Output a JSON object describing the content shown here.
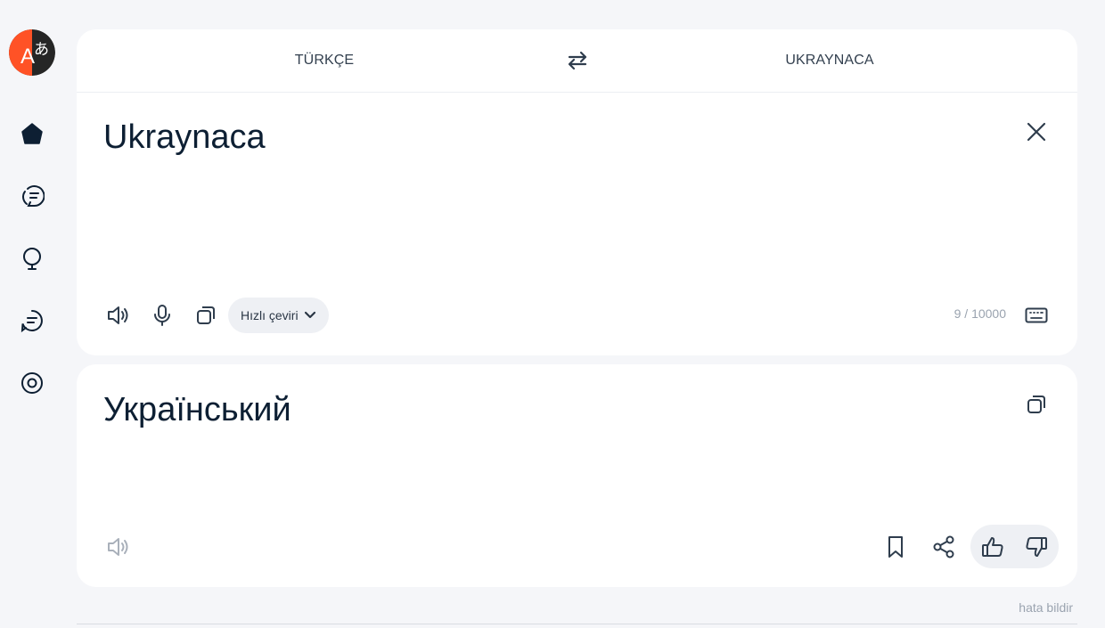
{
  "logo": {
    "icon": "translate-logo-icon",
    "colors": {
      "left": "#ff5226",
      "right": "#262626"
    },
    "glyphs": "A あ"
  },
  "sidebar": {
    "items": [
      {
        "name": "home",
        "icon": "home-icon"
      },
      {
        "name": "dialogue",
        "icon": "chat-bubbles-icon"
      },
      {
        "name": "ideas",
        "icon": "lightbulb-icon"
      },
      {
        "name": "documents",
        "icon": "document-icon"
      },
      {
        "name": "camera",
        "icon": "camera-icon"
      }
    ]
  },
  "languages": {
    "source": "TÜRKÇE",
    "target": "UKRAYNACA",
    "swap_icon": "swap-arrows-icon"
  },
  "source": {
    "text": "Ukraynaca",
    "counter": "9 / 10000",
    "quick_translate_label": "Hızlı çeviri",
    "icons": [
      "speaker-icon",
      "microphone-icon",
      "copy-icon",
      "chevron-down-icon",
      "keyboard-icon",
      "close-icon"
    ]
  },
  "result": {
    "text": "Український",
    "icons": [
      "speaker-icon",
      "copy-icon",
      "bookmark-icon",
      "share-icon",
      "thumbs-up-icon",
      "thumbs-down-icon"
    ]
  },
  "footer": {
    "report_label": "hata bildir"
  },
  "colors": {
    "background": "#f5f6f9",
    "card": "#ffffff",
    "text": "#0d1f33",
    "muted": "#9aa3af",
    "pill": "#eef0f4"
  }
}
